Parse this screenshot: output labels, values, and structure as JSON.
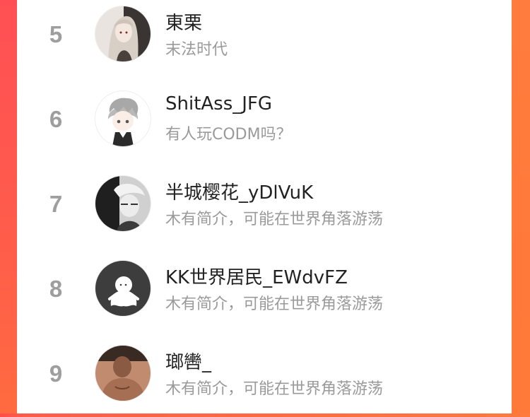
{
  "colors": {
    "accent_left": "#ff4d4f",
    "accent_right": "#ff7a3d",
    "rank": "#9e9e9e",
    "name": "#222222",
    "subtitle": "#9a9a9a"
  },
  "ranking": {
    "entries": [
      {
        "rank": "5",
        "name": "東栗",
        "subtitle": "末法时代",
        "avatar": "anime-girl-avatar"
      },
      {
        "rank": "6",
        "name": "ShitAss_JFG",
        "subtitle": "有人玩CODM吗？",
        "avatar": "anime-boy-avatar"
      },
      {
        "rank": "7",
        "name": "半城樱花_yDlVuK",
        "subtitle": "木有简介，可能在世界角落游荡",
        "avatar": "manga-boy-avatar"
      },
      {
        "rank": "8",
        "name": "KK世界居民_EWdvFZ",
        "subtitle": "木有简介，可能在世界角落游荡",
        "avatar": "default-ghost-avatar"
      },
      {
        "rank": "9",
        "name": "瑯轡_",
        "subtitle": "木有简介，可能在世界角落游荡",
        "avatar": "photo-person-avatar"
      }
    ]
  }
}
